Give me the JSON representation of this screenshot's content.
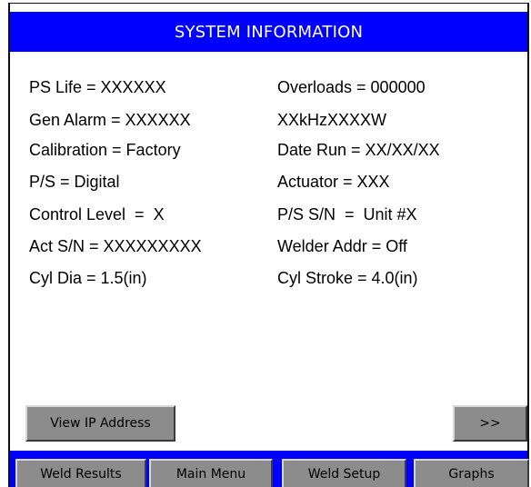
{
  "header": {
    "title": "SYSTEM INFORMATION"
  },
  "info": {
    "left": [
      "PS Life = XXXXXX",
      "Gen Alarm = XXXXXX",
      "Calibration = Factory",
      "P/S = Digital",
      "Control Level  =  X",
      "Act S/N = XXXXXXXXX",
      "Cyl Dia = 1.5(in)"
    ],
    "right": [
      "Overloads = 000000",
      "XXkHzXXXXW",
      "Date Run = XX/XX/XX",
      "Actuator = XXX",
      "P/S S/N  =  Unit #X",
      "Welder Addr = Off",
      "Cyl Stroke = 4.0(in)"
    ]
  },
  "buttons": {
    "view_ip": "View IP Address",
    "next": ">>"
  },
  "nav": {
    "weld_results": "Weld Results",
    "main_menu": "Main Menu",
    "weld_setup": "Weld Setup",
    "graphs": "Graphs"
  },
  "colors": {
    "title_bar": "#0000ff",
    "button": "#8c8c8c"
  }
}
